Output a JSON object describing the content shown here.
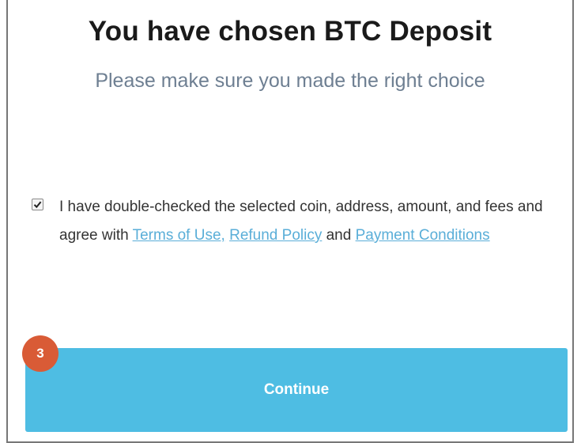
{
  "dialog": {
    "title": "You have chosen BTC Deposit",
    "subtitle": "Please make sure you made the right choice"
  },
  "agreement": {
    "checked": true,
    "text_part1": "I have double-checked the selected coin, address, amount, and fees and agree with ",
    "terms_link": "Terms of Use,",
    "separator": " ",
    "refund_link": "Refund Policy",
    "text_part2": " and ",
    "payment_link": "Payment Conditions"
  },
  "continue_label": "Continue",
  "step_badge": "3",
  "colors": {
    "button": "#4ebde3",
    "badge": "#d95b36",
    "link": "#5aaed8",
    "subtitle": "#6e7f92"
  }
}
